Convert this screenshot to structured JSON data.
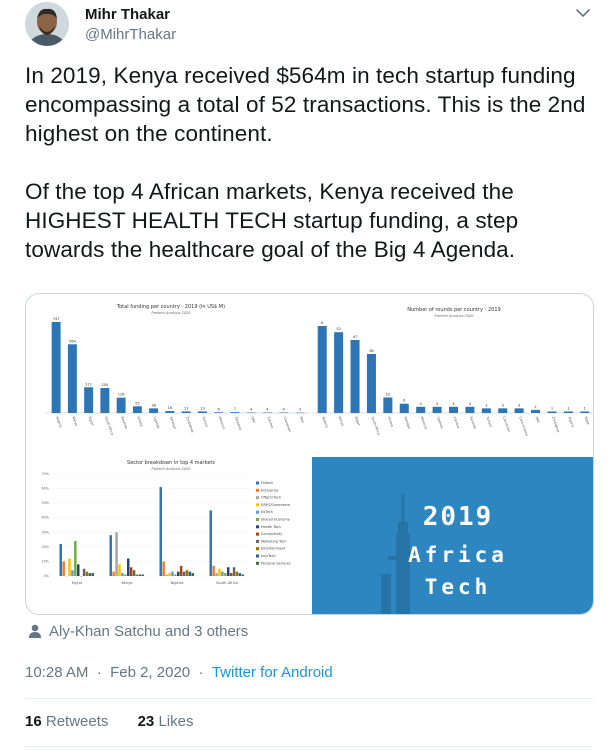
{
  "tweet": {
    "author_name": "Mihr Thakar",
    "author_handle": "@MihrThakar",
    "text": "In 2019, Kenya received $564m in tech startup funding encompassing a total of 52 transactions. This is the 2nd highest on the continent.\n\nOf the top 4 African markets, Kenya received the HIGHEST HEALTH TECH startup funding, a step towards the healthcare goal of the Big 4 Agenda.",
    "liked_by": "Aly-Khan Satchu and 3 others",
    "time": "10:28 AM",
    "date": "Feb 2, 2020",
    "source": "Twitter for Android",
    "retweets_count": "16",
    "retweets_label": "Retweets",
    "likes_count": "23",
    "likes_label": "Likes"
  },
  "colors": {
    "accent": "#1b95e0",
    "chart_bar": "#2e75b6",
    "banner_bg": "#2e86c1"
  },
  "icons": {
    "menu": "chevron-down-icon",
    "liked_by": "person-icon"
  },
  "banner": {
    "year": "2019",
    "line1": "Africa",
    "line2": "Tech"
  },
  "chart_data": [
    {
      "type": "bar",
      "title": "Total funding per country - 2019 (in US$ M)",
      "subtitle": "Partech Analysis 2020",
      "categories": [
        "Nigeria",
        "Kenya",
        "Egypt",
        "South Africa",
        "Rwanda",
        "Ghana",
        "Uganda",
        "Senegal",
        "Zimbabwe",
        "Tunisia",
        "Morocco",
        "Tanzania",
        "DRC",
        "Zambia",
        "Cameroon",
        "Mali"
      ],
      "values": [
        747,
        564,
        211,
        205,
        126,
        55,
        38,
        16,
        13,
        13,
        6,
        7,
        4,
        4,
        4,
        3
      ],
      "labels": [
        "747",
        "564",
        "211",
        "205",
        "126",
        "55",
        "38",
        "16",
        "13",
        "13",
        "6",
        "7",
        "4",
        "4",
        "4",
        "3"
      ]
    },
    {
      "type": "bar",
      "title": "Number of rounds per country - 2019",
      "subtitle": "Partech Analysis 2020",
      "categories": [
        "Nigeria",
        "Kenya",
        "Egypt",
        "South Africa",
        "Ghana",
        "Senegal",
        "Morocco",
        "Uganda",
        "Zambia",
        "Rwanda",
        "Tunisia",
        "Cameroon",
        "Cote d'Ivoire",
        "DRC",
        "Zimbabwe",
        "Algeria",
        "Niger"
      ],
      "values": [
        56,
        52,
        47,
        38,
        10,
        6,
        4,
        4,
        4,
        4,
        3,
        3,
        3,
        2,
        1,
        1,
        1
      ],
      "labels": [
        "6",
        "52",
        "47",
        "38",
        "10",
        "6",
        "4",
        "4",
        "4",
        "4",
        "3",
        "3",
        "3",
        "2",
        "1",
        "1",
        "1"
      ]
    },
    {
      "type": "bar",
      "title": "Sector breakdown in top 4 markets",
      "subtitle": "Partech Analysis 2020",
      "categories": [
        "Egypt",
        "Kenya",
        "Nigeria",
        "South Africa"
      ],
      "y_ticks": [
        "0%",
        "10%",
        "20%",
        "30%",
        "40%",
        "50%",
        "60%",
        "70%"
      ],
      "legend": [
        "Fintech",
        "Enterprise",
        "Offgrid Tech",
        "E/M/S/Commerce",
        "EdTech",
        "Shared Economy",
        "Health Tech",
        "Connectivity",
        "Marketing Tech",
        "Entertainment",
        "InsuTech",
        "Personal Services"
      ],
      "series_colors": [
        "#2e75b6",
        "#ed7d31",
        "#a5a5a5",
        "#ffc000",
        "#5b9bd5",
        "#70ad47",
        "#264478",
        "#9e480e",
        "#636363",
        "#997300",
        "#255e91",
        "#43682b"
      ],
      "series": [
        {
          "name": "Fintech",
          "values": [
            0.22,
            0.28,
            0.61,
            0.45
          ]
        },
        {
          "name": "Enterprise",
          "values": [
            0.1,
            0.03,
            0.1,
            0.07
          ]
        },
        {
          "name": "Offgrid Tech",
          "values": [
            0.0,
            0.3,
            0.01,
            0.02
          ]
        },
        {
          "name": "E/M/S/Commerce",
          "values": [
            0.12,
            0.08,
            0.02,
            0.05
          ]
        },
        {
          "name": "EdTech",
          "values": [
            0.04,
            0.02,
            0.03,
            0.03
          ]
        },
        {
          "name": "Shared Economy",
          "values": [
            0.24,
            0.01,
            0.01,
            0.02
          ]
        },
        {
          "name": "Health Tech",
          "values": [
            0.08,
            0.12,
            0.03,
            0.06
          ]
        },
        {
          "name": "Connectivity",
          "values": [
            0.0,
            0.06,
            0.07,
            0.02
          ]
        },
        {
          "name": "Marketing Tech",
          "values": [
            0.05,
            0.04,
            0.03,
            0.06
          ]
        },
        {
          "name": "Entertainment",
          "values": [
            0.03,
            0.01,
            0.04,
            0.03
          ]
        },
        {
          "name": "InsuTech",
          "values": [
            0.02,
            0.01,
            0.03,
            0.02
          ]
        },
        {
          "name": "Personal Services",
          "values": [
            0.02,
            0.01,
            0.02,
            0.01
          ]
        }
      ]
    }
  ]
}
